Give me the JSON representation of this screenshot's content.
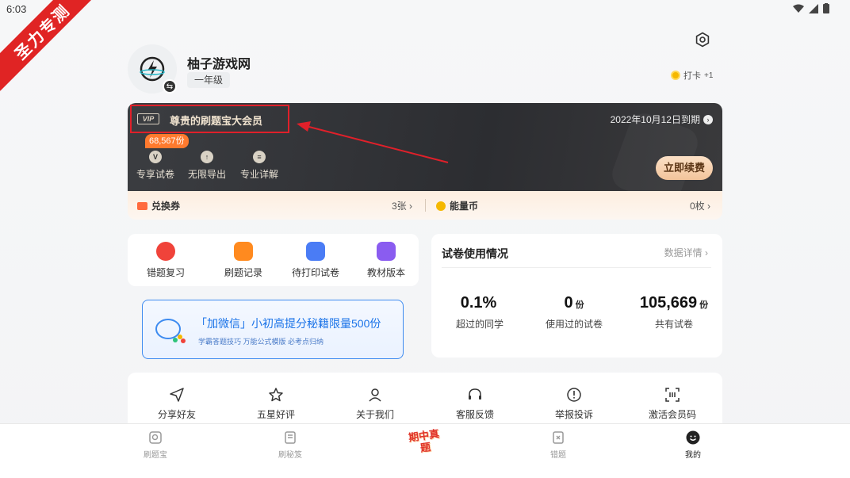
{
  "status_bar": {
    "time": "6:03"
  },
  "watermark": {
    "text": "圣力专测"
  },
  "profile": {
    "username": "柚子游戏网",
    "grade": "一年级",
    "checkin_label": "打卡",
    "checkin_bonus": "+1"
  },
  "vip": {
    "badge": "VIP",
    "title": "尊贵的刷题宝大会员",
    "expiry": "2022年10月12日到期",
    "count_badge": "68,567份",
    "perks": [
      {
        "label": "专享试卷",
        "icon": "paper-icon"
      },
      {
        "label": "无限导出",
        "icon": "export-icon"
      },
      {
        "label": "专业详解",
        "icon": "doc-icon"
      }
    ],
    "renew_label": "立即续费"
  },
  "wallet": {
    "voucher_label": "兑换券",
    "voucher_value": "3张",
    "energy_label": "能量币",
    "energy_value": "0枚"
  },
  "tools": [
    {
      "label": "错题复习",
      "icon": "wrong-review-icon",
      "color": "#f0433a"
    },
    {
      "label": "刷题记录",
      "icon": "record-icon",
      "color": "#ff8a1f"
    },
    {
      "label": "待打印试卷",
      "icon": "printer-icon",
      "color": "#4a7cf5"
    },
    {
      "label": "教材版本",
      "icon": "textbook-icon",
      "color": "#8a5cf0"
    }
  ],
  "promo": {
    "title": "「加微信」小初高提分秘籍限量500份",
    "subtitle": "学霸答题技巧  万能公式模版  必考点归纳"
  },
  "stats": {
    "title": "试卷使用情况",
    "link": "数据详情",
    "items": [
      {
        "value": "0.1%",
        "unit": "",
        "caption": "超过的同学"
      },
      {
        "value": "0",
        "unit": "份",
        "caption": "使用过的试卷"
      },
      {
        "value": "105,669",
        "unit": "份",
        "caption": "共有试卷"
      }
    ]
  },
  "more": [
    {
      "label": "分享好友",
      "icon": "share-icon"
    },
    {
      "label": "五星好评",
      "icon": "star-icon"
    },
    {
      "label": "关于我们",
      "icon": "user-icon"
    },
    {
      "label": "客服反馈",
      "icon": "headset-icon"
    },
    {
      "label": "举报投诉",
      "icon": "alert-icon"
    },
    {
      "label": "激活会员码",
      "icon": "scan-icon"
    }
  ],
  "nav": {
    "items": [
      {
        "label": "刷题宝",
        "icon": "home-icon"
      },
      {
        "label": "刷秘笈",
        "icon": "book-icon"
      },
      {
        "label": "错题",
        "icon": "wrong-icon"
      },
      {
        "label": "我的",
        "icon": "profile-icon"
      }
    ],
    "center_label": "期中真题"
  },
  "colors": {
    "accent_red": "#e0202a",
    "vip_dark": "#2c2d31",
    "promo_blue": "#1a73e8"
  }
}
